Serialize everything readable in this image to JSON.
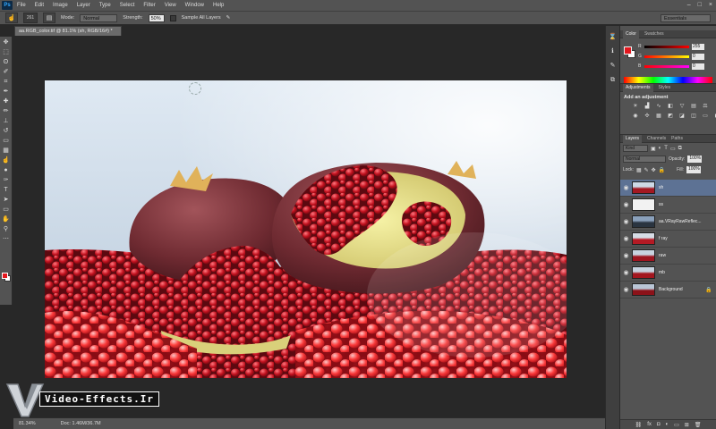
{
  "app": {
    "logo": "Ps"
  },
  "menu": [
    "File",
    "Edit",
    "Image",
    "Layer",
    "Type",
    "Select",
    "Filter",
    "View",
    "Window",
    "Help"
  ],
  "window_controls": [
    "–",
    "□",
    "×"
  ],
  "options_bar": {
    "tool_icon": "smudge-icon",
    "brush_size": "261",
    "mode_label": "Mode:",
    "mode_value": "Normal",
    "strength_label": "Strength:",
    "strength_value": "50%",
    "sample_label": "Sample All Layers",
    "workspace": "Essentials"
  },
  "document": {
    "tab_title": "aa.RGB_color.tif @ 81.1% (sh, RGB/16#) *",
    "status_zoom": "81.34%",
    "status_doc": "Doc: 1.46M/36.7M"
  },
  "watermark": {
    "text": "Video-Effects.Ir"
  },
  "color_panel": {
    "tabs": [
      "Color",
      "Swatches"
    ],
    "sliders": [
      {
        "label": "R",
        "value": "255"
      },
      {
        "label": "G",
        "value": "0"
      },
      {
        "label": "B",
        "value": "0"
      }
    ]
  },
  "adjustments_panel": {
    "tabs": [
      "Adjustments",
      "Styles"
    ],
    "title": "Add an adjustment"
  },
  "layers_panel": {
    "tabs": [
      "Layers",
      "Channels",
      "Paths"
    ],
    "kind_label": "Kind",
    "blend_mode": "Normal",
    "opacity_label": "Opacity:",
    "opacity_value": "100%",
    "lock_label": "Lock:",
    "fill_label": "Fill:",
    "fill_value": "100%",
    "layers": [
      {
        "name": "sh",
        "selected": true
      },
      {
        "name": "ss",
        "selected": false
      },
      {
        "name": "aa.VRayRawReflec...",
        "selected": false
      },
      {
        "name": "f ray",
        "selected": false
      },
      {
        "name": "raw",
        "selected": false
      },
      {
        "name": "mb",
        "selected": false
      },
      {
        "name": "Background",
        "selected": false,
        "locked": true
      }
    ]
  },
  "colors": {
    "foreground": "#e3171e",
    "background": "#ffffff",
    "panel": "#535353",
    "canvas_bg": "#282828",
    "selection": "#5d7294"
  }
}
